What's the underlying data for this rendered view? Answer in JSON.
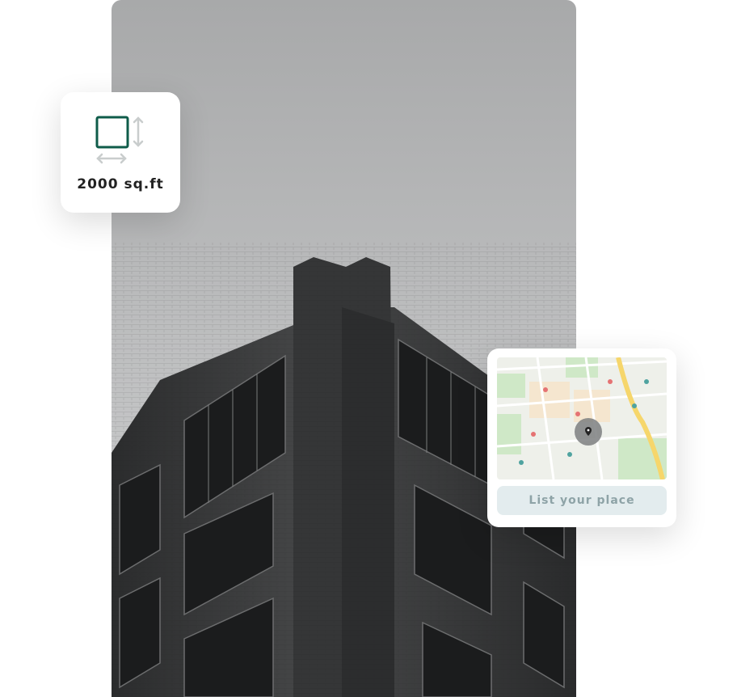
{
  "hero": {
    "image_icon": "building-photo",
    "sky_color": "#a8a9aa",
    "brick_color": "#3a3a3a"
  },
  "area_card": {
    "icon": "floor-area-icon",
    "accent": "#0f5c4a",
    "label": "2000 sq.ft"
  },
  "map_card": {
    "icon": "map-pin-icon",
    "button_label": "List your place",
    "button_bg": "#e3ecee",
    "button_text_color": "#8ea3a7"
  }
}
